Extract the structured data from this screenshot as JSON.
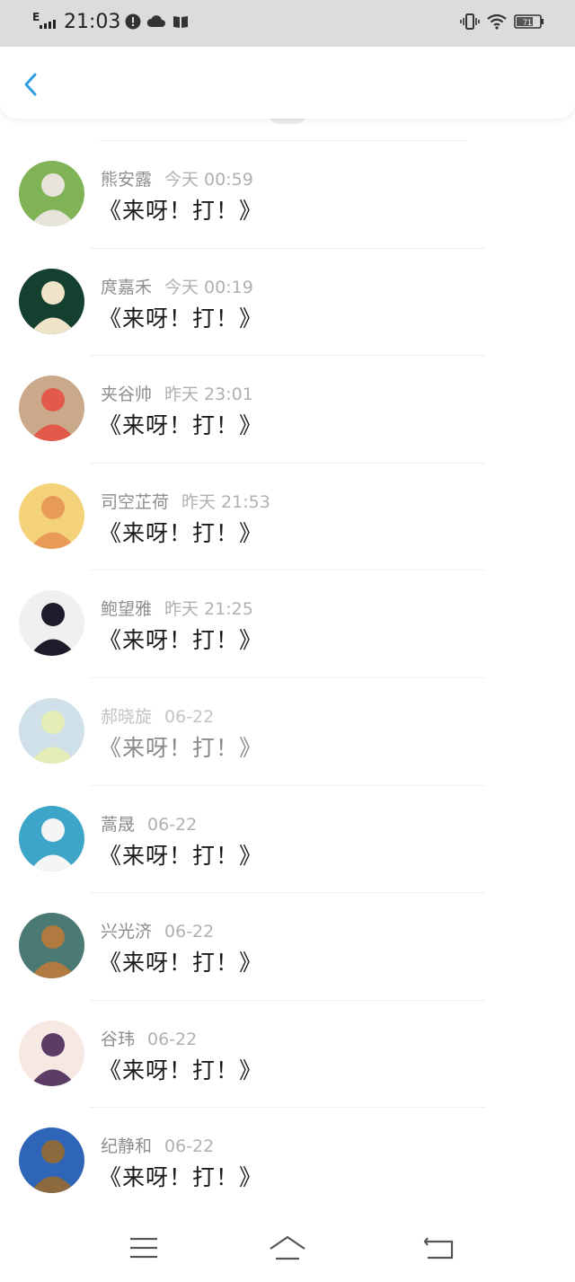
{
  "status_bar": {
    "network": "E",
    "time": "21:03",
    "battery": "71",
    "icons": [
      "alert-icon",
      "cloud-icon",
      "book-icon",
      "vibrate-icon",
      "wifi-icon",
      "battery-icon"
    ]
  },
  "header": {
    "back_icon": "chevron-left-icon",
    "accent_color": "#2e9fe6"
  },
  "messages": [
    {
      "name": "熊安露",
      "time": "今天 00:59",
      "text": "《来呀！打！》",
      "faded": false,
      "avatar_colors": [
        "#7fb356",
        "#e8e4dc"
      ]
    },
    {
      "name": "庹嘉禾",
      "time": "今天 00:19",
      "text": "《来呀！打！》",
      "faded": false,
      "avatar_colors": [
        "#14402f",
        "#efe3c8"
      ]
    },
    {
      "name": "夹谷帅",
      "time": "昨天 23:01",
      "text": "《来呀！打！》",
      "faded": false,
      "avatar_colors": [
        "#c9a98a",
        "#e35a4a"
      ]
    },
    {
      "name": "司空芷荷",
      "time": "昨天 21:53",
      "text": "《来呀！打！》",
      "faded": false,
      "avatar_colors": [
        "#f4d27a",
        "#e79b56"
      ]
    },
    {
      "name": "鲍望雅",
      "time": "昨天 21:25",
      "text": "《来呀！打！》",
      "faded": false,
      "avatar_colors": [
        "#f0f0f0",
        "#1c1c2a"
      ]
    },
    {
      "name": "郝晓旋",
      "time": "06-22",
      "text": "《来呀！打！》",
      "faded": true,
      "avatar_colors": [
        "#a9c7d6",
        "#cfe07a"
      ]
    },
    {
      "name": "蒿晟",
      "time": "06-22",
      "text": "《来呀！打！》",
      "faded": false,
      "avatar_colors": [
        "#3da6c8",
        "#f5f5f5"
      ]
    },
    {
      "name": "兴光济",
      "time": "06-22",
      "text": "《来呀！打！》",
      "faded": false,
      "avatar_colors": [
        "#4b7a74",
        "#b07a40"
      ]
    },
    {
      "name": "谷玮",
      "time": "06-22",
      "text": "《来呀！打！》",
      "faded": false,
      "avatar_colors": [
        "#f6e8e2",
        "#5a3c64"
      ]
    },
    {
      "name": "纪静和",
      "time": "06-22",
      "text": "《来呀！打！》",
      "faded": false,
      "avatar_colors": [
        "#2e65b8",
        "#8c6a3e"
      ]
    }
  ],
  "bottom_nav": {
    "icons": [
      "menu-icon",
      "home-icon",
      "back-nav-icon"
    ]
  }
}
